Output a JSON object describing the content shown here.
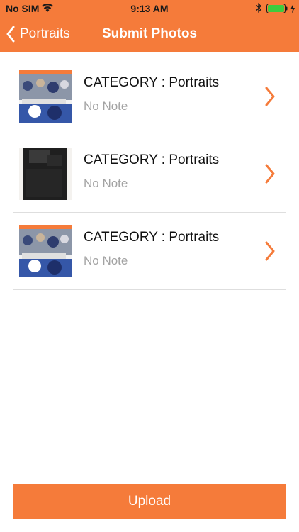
{
  "status_bar": {
    "carrier": "No SIM",
    "time": "9:13 AM",
    "battery_color": "#3ecb3e"
  },
  "nav": {
    "back_label": "Portraits",
    "title": "Submit Photos"
  },
  "items": [
    {
      "title": "CATEGORY : Portraits",
      "note": "No Note",
      "thumbnail": "crowd-photo"
    },
    {
      "title": "CATEGORY : Portraits",
      "note": "No Note",
      "thumbnail": "dark-object-photo"
    },
    {
      "title": "CATEGORY : Portraits",
      "note": "No Note",
      "thumbnail": "crowd-photo"
    }
  ],
  "upload": {
    "label": "Upload"
  },
  "colors": {
    "accent": "#f57b3a",
    "note_text": "#a3a3a3",
    "divider": "#dedede"
  }
}
